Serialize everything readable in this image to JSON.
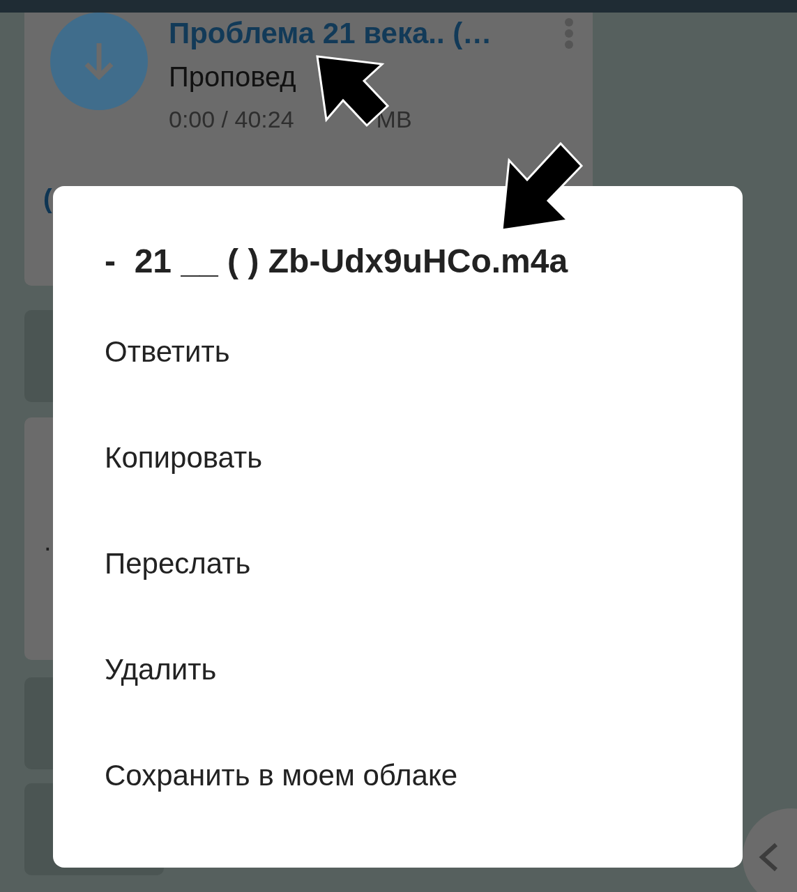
{
  "chat": {
    "messages": [
      {
        "kind": "audio",
        "title": "Проблема 21 века.. (…",
        "subtitle": "Проповед",
        "meta": "0:00 / 40:24",
        "size_unit": "MB",
        "link_fragment": "("
      },
      {
        "kind": "media"
      },
      {
        "kind": "text",
        "lines": [
          "."
        ]
      },
      {
        "kind": "media"
      },
      {
        "kind": "media"
      }
    ]
  },
  "dialog": {
    "title": "-  21 __ ( ) Zb-Udx9uHCo.m4a",
    "items": [
      "Ответить",
      "Копировать",
      "Переслать",
      "Удалить",
      "Сохранить в моем облаке"
    ]
  }
}
